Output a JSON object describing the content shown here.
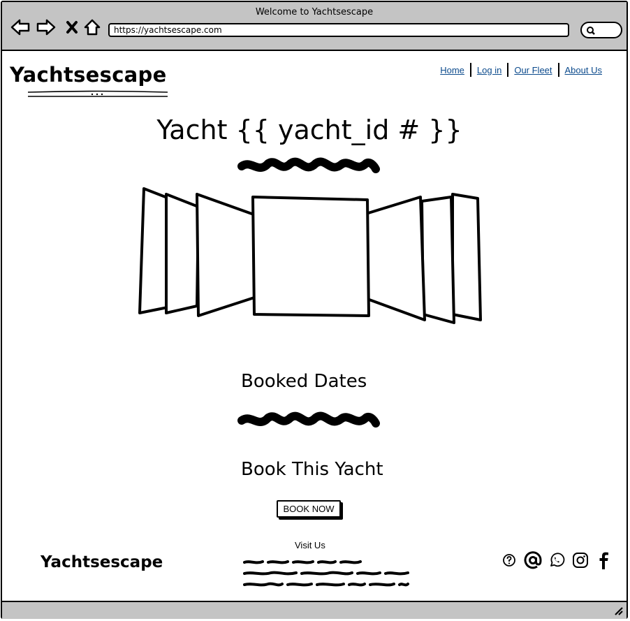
{
  "browser": {
    "title": "Welcome to Yachtsescape",
    "url": "https://yachtsescape.com"
  },
  "header": {
    "logo": "Yachtsescape",
    "nav": [
      "Home",
      "Log in",
      "Our Fleet",
      "About Us"
    ]
  },
  "main": {
    "title": "Yacht {{ yacht_id # }}",
    "booked_heading": "Booked Dates",
    "book_heading": "Book This Yacht",
    "book_button": "BOOK NOW"
  },
  "footer": {
    "logo": "Yachtsescape",
    "visit_heading": "Visit Us",
    "social_icons": [
      "help-icon",
      "email-icon",
      "whatsapp-icon",
      "instagram-icon",
      "facebook-icon"
    ]
  }
}
